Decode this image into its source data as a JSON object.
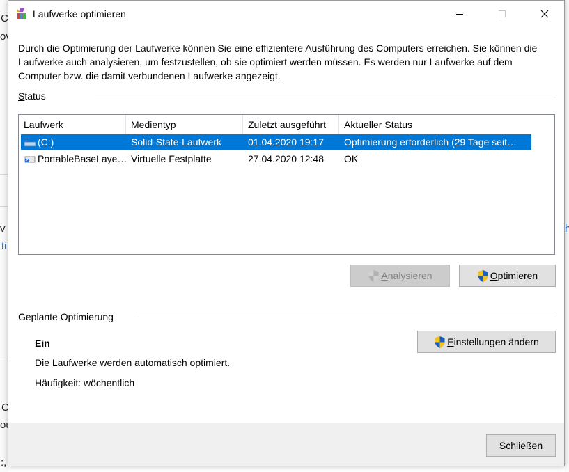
{
  "window": {
    "title": "Laufwerke optimieren",
    "icon": "defrag-icon"
  },
  "description": "Durch die Optimierung der Laufwerke können Sie eine effizientere Ausführung des Computers erreichen. Sie können die Laufwerke auch analysieren, um festzustellen, ob sie optimiert werden müssen. Es werden nur Laufwerke auf dem Computer bzw. die damit verbundenen Laufwerke angezeigt.",
  "status": {
    "label_pre": "",
    "label_mnemonic": "S",
    "label_post": "tatus",
    "columns": [
      "Laufwerk",
      "Medientyp",
      "Zuletzt ausgeführt",
      "Aktueller Status"
    ],
    "rows": [
      {
        "icon": "ssd-drive-icon",
        "drive": "(C:)",
        "media": "Solid-State-Laufwerk",
        "last_run": "01.04.2020 19:17",
        "status": "Optimierung erforderlich (29 Tage seit…",
        "selected": true
      },
      {
        "icon": "virtual-disk-icon",
        "drive": "PortableBaseLaye…",
        "media": "Virtuelle Festplatte",
        "last_run": "27.04.2020 12:48",
        "status": "OK",
        "selected": false
      }
    ],
    "analyze_pre": "",
    "analyze_mnemonic": "A",
    "analyze_post": "nalysieren",
    "optimize_pre": "",
    "optimize_mnemonic": "O",
    "optimize_post": "ptimieren"
  },
  "scheduled": {
    "label": "Geplante Optimierung",
    "state": "Ein",
    "info": "Die Laufwerke werden automatisch optimiert.",
    "frequency": "Häufigkeit: wöchentlich",
    "settings_pre": "",
    "settings_mnemonic": "E",
    "settings_post": "instellungen ändern"
  },
  "footer": {
    "close_pre": "",
    "close_mnemonic": "S",
    "close_post": "chließen"
  },
  "background": {
    "frag1": "C",
    "frag2": "ov",
    "frag3": "v",
    "frag4": "ti",
    "frag5": "C",
    "frag6": "ou",
    "frag7": ":,",
    "frag8": "h"
  },
  "colors": {
    "selection": "#0078d7",
    "shield_blue": "#1c5fb8",
    "shield_yellow": "#f5c21b"
  }
}
